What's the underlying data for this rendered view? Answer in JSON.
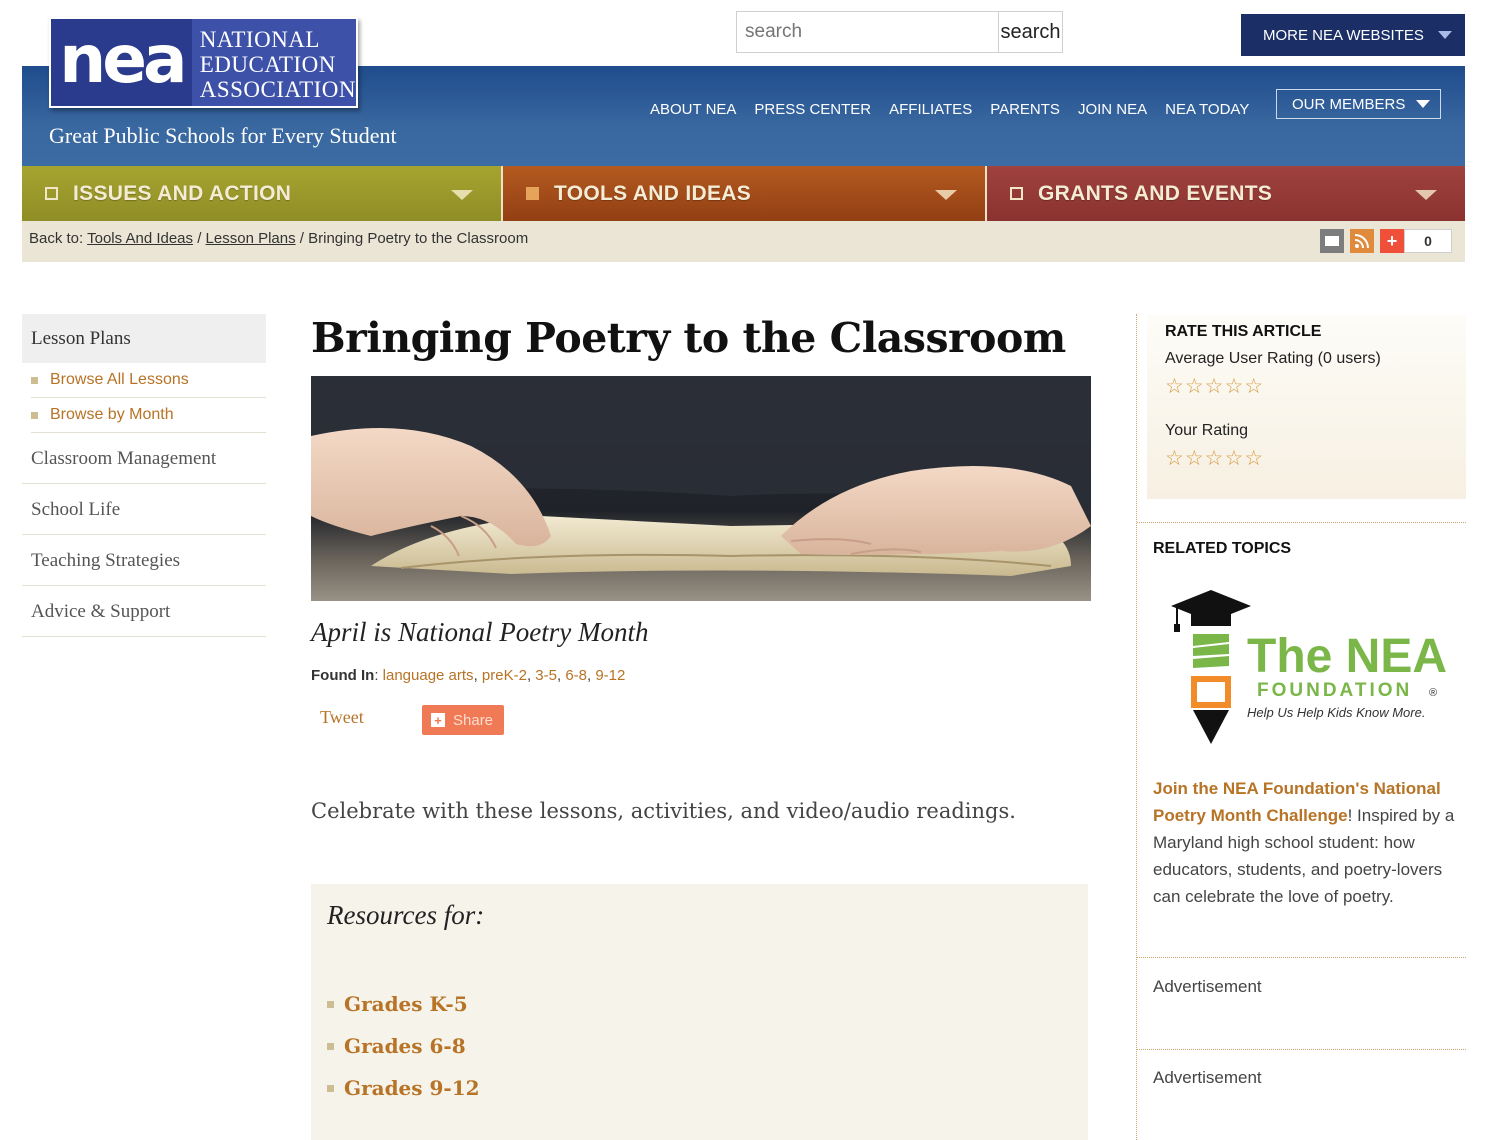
{
  "header": {
    "logo_mark": "nea",
    "logo_name": [
      "NATIONAL",
      "EDUCATION",
      "ASSOCIATION"
    ],
    "tagline": "Great Public Schools for Every Student",
    "search_placeholder": "search",
    "search_button": "search",
    "more_sites": "MORE NEA WEBSITES",
    "top_nav": [
      "ABOUT NEA",
      "PRESS CENTER",
      "AFFILIATES",
      "PARENTS",
      "JOIN NEA",
      "NEA TODAY"
    ],
    "our_members": "OUR MEMBERS"
  },
  "color_bar": {
    "issues": "ISSUES AND ACTION",
    "tools": "TOOLS AND IDEAS",
    "grants": "GRANTS AND EVENTS"
  },
  "breadcrumb": {
    "prefix": "Back to:",
    "crumb1": "Tools And Ideas",
    "crumb2": "Lesson Plans",
    "current": "Bringing Poetry to the Classroom",
    "sep": "/",
    "share_count": "0"
  },
  "sidebar": {
    "heading": "Lesson Plans",
    "sub_items": [
      "Browse All Lessons",
      "Browse by Month"
    ],
    "items": [
      "Classroom Management",
      "School Life",
      "Teaching Strategies",
      "Advice & Support"
    ]
  },
  "article": {
    "title": "Bringing Poetry to the Classroom",
    "subtitle": "April is National Poetry Month",
    "found_in_label": "Found In",
    "tags": [
      "language arts",
      "preK-2",
      "3-5",
      "6-8",
      "9-12"
    ],
    "tweet": "Tweet",
    "share": "Share",
    "intro": "Celebrate with these lessons, activities, and video/audio readings.",
    "resources_title": "Resources for:",
    "resources": [
      "Grades K-5",
      "Grades 6-8",
      "Grades 9-12"
    ]
  },
  "right": {
    "rate_heading": "RATE THIS ARTICLE",
    "avg_rating": "Average User Rating (0 users)",
    "your_rating": "Your Rating",
    "stars": "☆☆☆☆☆",
    "related_heading": "RELATED TOPICS",
    "foundation_logo": {
      "line1": "The NEA",
      "line2": "FOUNDATION",
      "reg": "®",
      "slogan": "Help Us Help Kids Know More."
    },
    "related_link": "Join the NEA Foundation's National Poetry Month Challenge",
    "related_text": "! Inspired by a Maryland high school student: how educators, students, and poetry-lovers can celebrate the love of poetry.",
    "ad1": "Advertisement",
    "ad2": "Advertisement"
  },
  "colors": {
    "link": "#b77326",
    "header_blue": "#2f5d98",
    "issues": "#a6a430",
    "tools": "#b45a20",
    "grants": "#a0423e"
  }
}
